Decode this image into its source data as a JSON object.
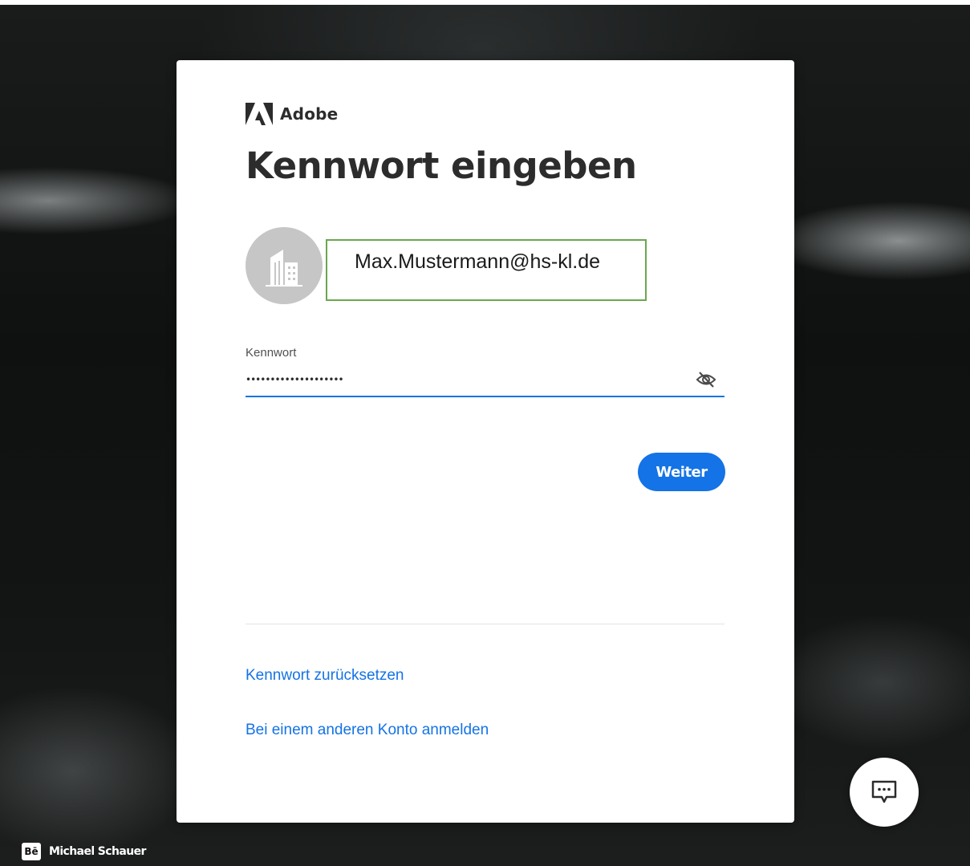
{
  "brand": {
    "name": "Adobe",
    "accent_color": "#1473e6",
    "logo_color": "#2c2c2c"
  },
  "page": {
    "title": "Kennwort eingeben"
  },
  "account": {
    "email": "Max.Mustermann@hs-kl.de",
    "avatar_icon": "building-icon"
  },
  "password_field": {
    "label": "Kennwort",
    "value": "••••••••••••••••••••",
    "toggle_icon": "eye-slash-icon"
  },
  "actions": {
    "continue_label": "Weiter"
  },
  "links": {
    "reset_password": "Kennwort zurücksetzen",
    "other_account": "Bei einem anderen Konto anmelden"
  },
  "chat": {
    "icon": "chat-bubble-icon"
  },
  "credit": {
    "badge": "Bē",
    "name": "Michael Schauer"
  }
}
